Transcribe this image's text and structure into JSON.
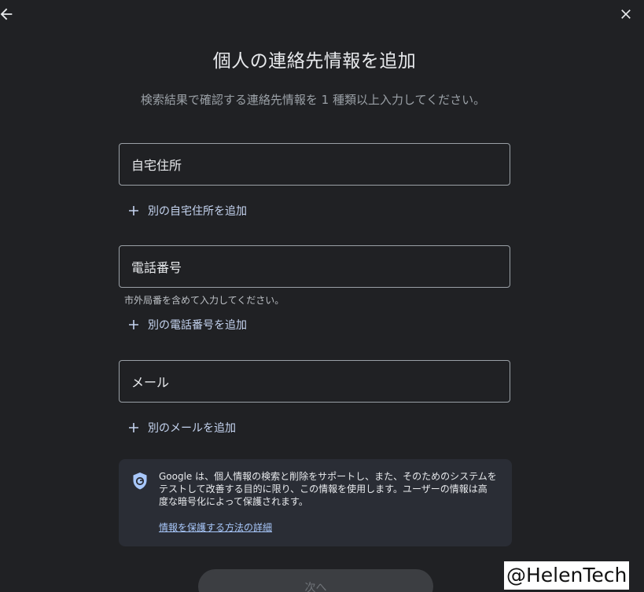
{
  "header": {
    "back_icon": "arrow-left-icon",
    "close_icon": "close-icon"
  },
  "title": "個人の連絡先情報を追加",
  "subtitle": "検索結果で確認する連絡先情報を 1 種類以上入力してください。",
  "fields": {
    "address": {
      "label": "自宅住所",
      "add_label": "別の自宅住所を追加"
    },
    "phone": {
      "label": "電話番号",
      "helper": "市外局番を含めて入力してください。",
      "add_label": "別の電話番号を追加"
    },
    "email": {
      "label": "メール",
      "add_label": "別のメールを追加"
    }
  },
  "info": {
    "icon": "google-shield-icon",
    "line1": "Google は、個人情報の検索と削除をサポートし、また、そのためのシステムを",
    "line2": "テストして改善する目的に限り、この情報を使用します。ユーザーの情報は高",
    "line3": "度な暗号化によって保護されます。",
    "link": "情報を保護する方法の詳細"
  },
  "next_button": "次へ",
  "watermark": "@HelenTech",
  "colors": {
    "background": "#202124",
    "link": "#c5d4f0",
    "info_bg": "#2a2d35"
  }
}
